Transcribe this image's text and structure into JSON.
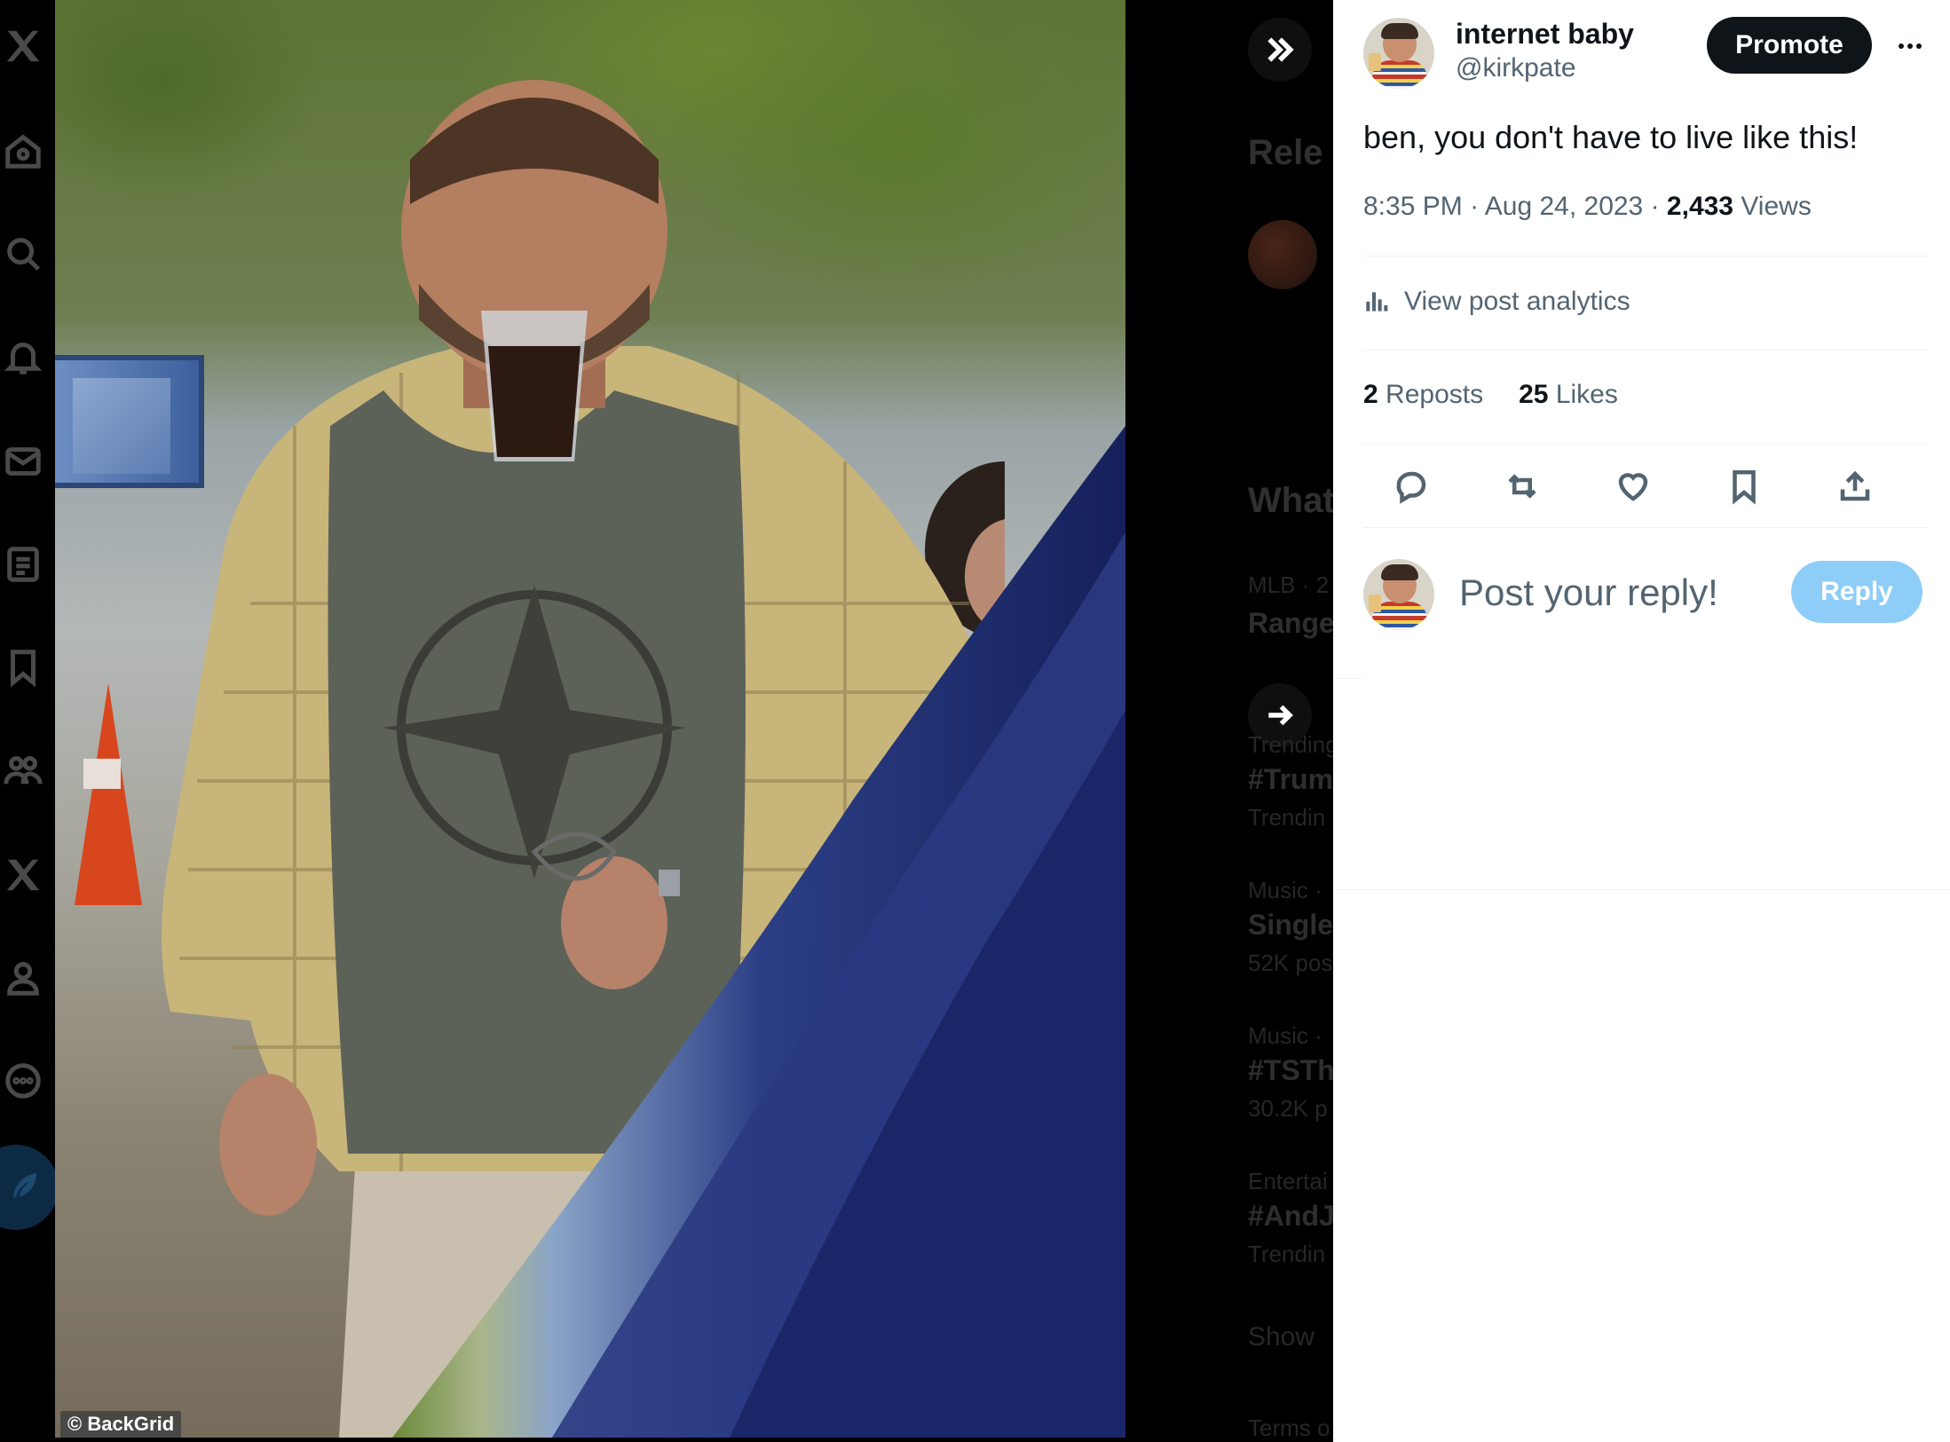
{
  "media": {
    "credit": "© BackGrid"
  },
  "backdrop": {
    "relevant_heading": "Rele",
    "whats_happening_heading": "What",
    "trends": [
      {
        "context": "MLB · 2",
        "title": "Range"
      },
      {
        "context": "Trending",
        "title": "#Trum",
        "sub": "Trendin"
      },
      {
        "context": "Music ·",
        "title": "Single",
        "sub": "52K pos"
      },
      {
        "context": "Music ·",
        "title": "#TSTh",
        "sub": "30.2K p"
      },
      {
        "context": "Entertai",
        "title": "#AndJ",
        "sub": "Trendin"
      }
    ],
    "show_more": "Show",
    "terms": "Terms o"
  },
  "post": {
    "display_name": "internet baby",
    "handle": "@kirkpate",
    "promote_label": "Promote",
    "text": "ben, you don't have to live like this!",
    "time": "8:35 PM",
    "date": "Aug 24, 2023",
    "views_count": "2,433",
    "views_label": "Views",
    "analytics_label": "View post analytics",
    "reposts_count": "2",
    "reposts_label": "Reposts",
    "likes_count": "25",
    "likes_label": "Likes"
  },
  "reply": {
    "placeholder": "Post your reply!",
    "button_label": "Reply"
  },
  "colors": {
    "accent_disabled": "#8ecdf8",
    "text_primary": "#0f1419",
    "text_secondary": "#536471"
  }
}
